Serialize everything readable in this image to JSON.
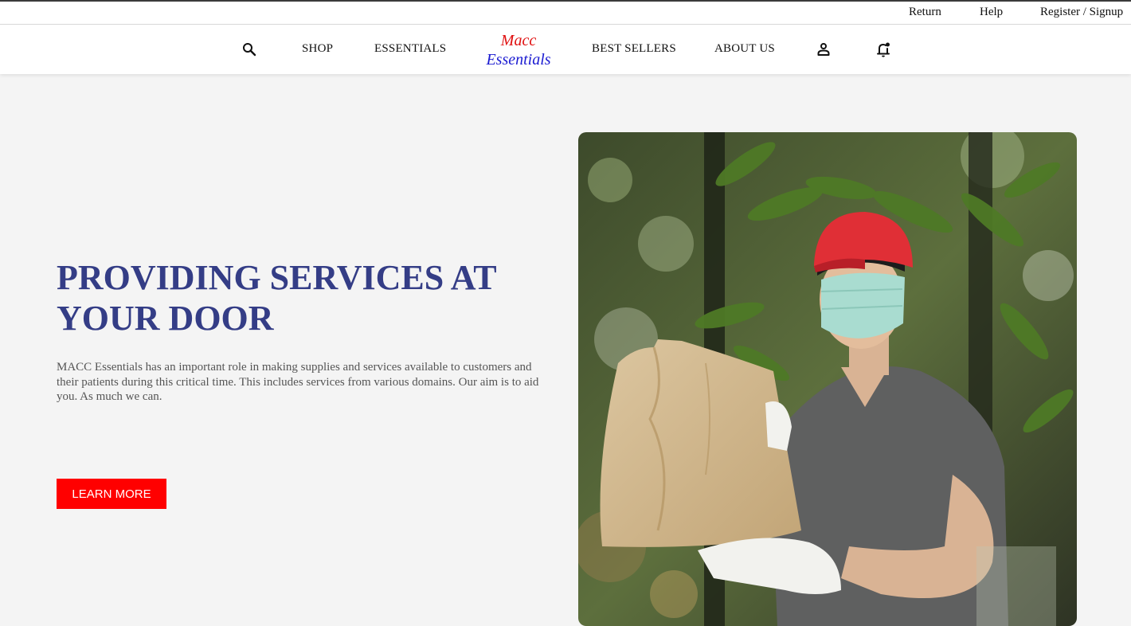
{
  "utility_nav": {
    "return_label": "Return",
    "help_label": "Help",
    "register_label": "Register / Signup"
  },
  "main_nav": {
    "search_icon": "search-icon",
    "items": [
      "SHOP",
      "ESSENTIALS",
      "BEST SELLERS",
      "ABOUT US"
    ],
    "account_icon": "person-icon",
    "notification_icon": "notification-bell-icon"
  },
  "logo": {
    "line1": "Macc",
    "line2": "Essentials",
    "line1_color": "#e01010",
    "line2_color": "#1b1bd1"
  },
  "hero": {
    "title": "PROVIDING SERVICES AT YOUR DOOR",
    "description": "MACC Essentials has an important role in making supplies and services available to customers and their patients during this critical time. This includes services from various domains. Our aim is to aid you. As much we can.",
    "cta_label": "LEARN MORE",
    "photo": "delivery person wearing red cap and face mask holding a paper bag"
  },
  "colors": {
    "accent": "#ff0000",
    "heading": "#343d86",
    "page_background": "#f4f4f4"
  }
}
